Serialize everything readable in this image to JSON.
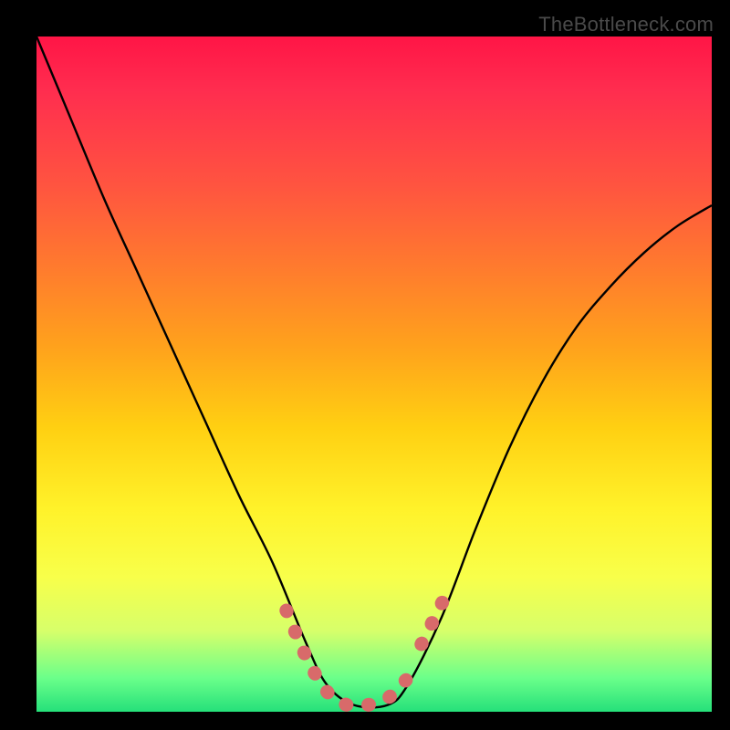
{
  "brand": {
    "label": "TheBottleneck.com"
  },
  "chart_data": {
    "type": "line",
    "title": "",
    "xlabel": "",
    "ylabel": "",
    "xlim": [
      0,
      1
    ],
    "ylim": [
      0,
      1
    ],
    "x": [
      0.0,
      0.05,
      0.1,
      0.15,
      0.2,
      0.25,
      0.3,
      0.35,
      0.4,
      0.43,
      0.47,
      0.52,
      0.55,
      0.6,
      0.65,
      0.7,
      0.75,
      0.8,
      0.85,
      0.9,
      0.95,
      1.0
    ],
    "y": [
      1.0,
      0.88,
      0.76,
      0.65,
      0.54,
      0.43,
      0.32,
      0.22,
      0.1,
      0.04,
      0.01,
      0.01,
      0.04,
      0.14,
      0.27,
      0.39,
      0.49,
      0.57,
      0.63,
      0.68,
      0.72,
      0.75
    ],
    "highlighted_segments": [
      {
        "x": [
          0.37,
          0.4,
          0.43,
          0.46,
          0.49,
          0.52,
          0.55
        ],
        "y": [
          0.15,
          0.08,
          0.03,
          0.01,
          0.01,
          0.02,
          0.05
        ]
      },
      {
        "x": [
          0.57,
          0.59,
          0.61
        ],
        "y": [
          0.1,
          0.14,
          0.18
        ]
      }
    ],
    "highlight_color": "#d86a6a",
    "curve_color": "#000000",
    "background": "gradient-red-yellow-green"
  }
}
